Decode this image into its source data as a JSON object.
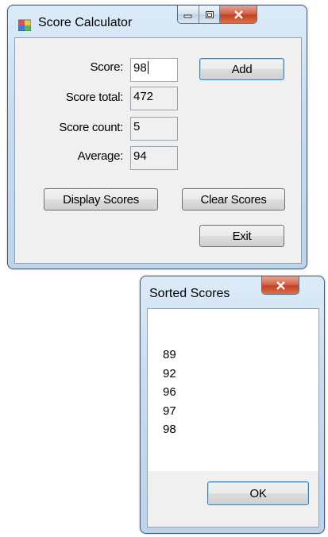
{
  "score_calculator": {
    "title": "Score Calculator",
    "controls": {
      "minimize": "—",
      "maximize": "□",
      "close": "X"
    },
    "score_label": "Score:",
    "score_value": "98",
    "score_total_label": "Score total:",
    "score_total_value": "472",
    "score_count_label": "Score count:",
    "score_count_value": "5",
    "average_label": "Average:",
    "average_value": "94",
    "add_button": "Add",
    "display_button": "Display Scores",
    "clear_button": "Clear Scores",
    "exit_button": "Exit"
  },
  "sorted_scores": {
    "title": "Sorted Scores",
    "close": "X",
    "scores": [
      "89",
      "92",
      "96",
      "97",
      "98"
    ],
    "ok_button": "OK"
  }
}
